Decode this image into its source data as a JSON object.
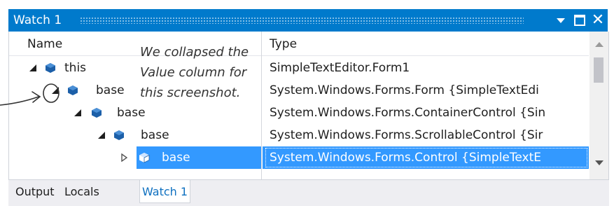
{
  "panel": {
    "title": "Watch 1"
  },
  "columns": {
    "name": "Name",
    "type": "Type"
  },
  "rows": [
    {
      "name": "this",
      "type": "SimpleTextEditor.Form1",
      "expanded": true,
      "depth": 0,
      "selected": false
    },
    {
      "name": "base",
      "type": "System.Windows.Forms.Form {SimpleTextEdi",
      "expanded": true,
      "depth": 1,
      "selected": false
    },
    {
      "name": "base",
      "type": "System.Windows.Forms.ContainerControl {Sin",
      "expanded": true,
      "depth": 2,
      "selected": false
    },
    {
      "name": "base",
      "type": "System.Windows.Forms.ScrollableControl {Sir",
      "expanded": true,
      "depth": 3,
      "selected": false
    },
    {
      "name": "base",
      "type": "System.Windows.Forms.Control {SimpleTextE",
      "expanded": false,
      "depth": 4,
      "selected": true
    }
  ],
  "annotation": {
    "lines": [
      "We collapsed the",
      "Value column for",
      "this screenshot."
    ]
  },
  "tabs": [
    {
      "label": "Output",
      "active": false
    },
    {
      "label": "Locals",
      "active": false
    },
    {
      "label": "Watch 1",
      "active": true
    }
  ],
  "colors": {
    "titlebar": "#007acc",
    "selection": "#3399ff",
    "object_icon": "#1c5fa8",
    "active_tab_text": "#0e70c0"
  },
  "icons": {
    "row_icon": "object-icon",
    "expanded_marker": "expanded-triangle-icon",
    "collapsed_marker": "collapsed-triangle-icon"
  }
}
